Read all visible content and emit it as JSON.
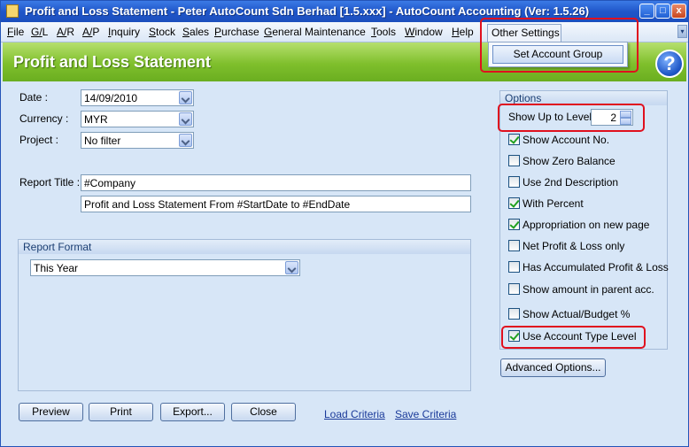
{
  "window": {
    "title": "Profit and Loss Statement - Peter AutoCount Sdn Berhad [1.5.xxx] - AutoCount Accounting (Ver: 1.5.26)",
    "controls": [
      "_",
      "□",
      "x"
    ]
  },
  "menu": {
    "items": [
      "File",
      "G/L",
      "A/R",
      "A/P",
      "Inquiry",
      "Stock",
      "Sales",
      "Purchase",
      "General Maintenance",
      "Tools",
      "Window",
      "Help"
    ],
    "other_settings": "Other Settings",
    "dropdown_item": "Set Account Group",
    "chevron": "▾"
  },
  "header": {
    "title": "Profit and Loss Statement",
    "help": "?"
  },
  "form": {
    "date_label": "Date :",
    "date_value": "14/09/2010",
    "currency_label": "Currency :",
    "currency_value": "MYR",
    "project_label": "Project :",
    "project_value": "No filter",
    "report_title_label": "Report Title :",
    "report_title_1": "#Company",
    "report_title_2": "Profit and Loss Statement From #StartDate to #EndDate"
  },
  "report_format": {
    "title": "Report Format",
    "value": "This Year"
  },
  "options": {
    "title": "Options",
    "level_label": "Show Up to Level",
    "level_value": "2",
    "checkboxes": [
      {
        "label": "Show Account No.",
        "checked": true
      },
      {
        "label": "Show Zero Balance",
        "checked": false
      },
      {
        "label": "Use 2nd Description",
        "checked": false
      },
      {
        "label": "With Percent",
        "checked": true
      },
      {
        "label": "Appropriation on new page",
        "checked": true
      },
      {
        "label": "Net Profit & Loss only",
        "checked": false
      },
      {
        "label": "Has Accumulated Profit & Loss",
        "checked": false
      },
      {
        "label": "Show amount in parent acc.",
        "checked": false
      },
      {
        "label": "Show Actual/Budget %",
        "checked": false
      },
      {
        "label": "Use Account Type Level",
        "checked": true
      }
    ],
    "advanced_button": "Advanced Options..."
  },
  "buttons": {
    "preview": "Preview",
    "print": "Print",
    "export": "Export...",
    "close": "Close",
    "load_criteria": "Load Criteria",
    "save_criteria": "Save Criteria"
  },
  "colors": {
    "title_bar": "#2056c9",
    "header_green": "#7fbf2c",
    "panel_bg": "#d7e6f7",
    "highlight_red": "#e0101e"
  }
}
